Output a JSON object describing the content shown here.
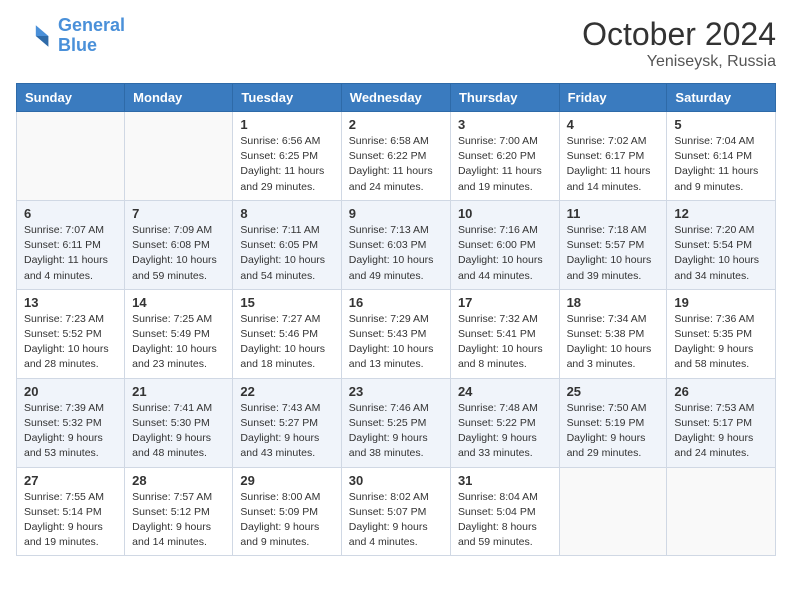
{
  "header": {
    "logo_line1": "General",
    "logo_line2": "Blue",
    "month": "October 2024",
    "location": "Yeniseysk, Russia"
  },
  "weekdays": [
    "Sunday",
    "Monday",
    "Tuesday",
    "Wednesday",
    "Thursday",
    "Friday",
    "Saturday"
  ],
  "weeks": [
    [
      {
        "day": "",
        "info": ""
      },
      {
        "day": "",
        "info": ""
      },
      {
        "day": "1",
        "info": "Sunrise: 6:56 AM\nSunset: 6:25 PM\nDaylight: 11 hours\nand 29 minutes."
      },
      {
        "day": "2",
        "info": "Sunrise: 6:58 AM\nSunset: 6:22 PM\nDaylight: 11 hours\nand 24 minutes."
      },
      {
        "day": "3",
        "info": "Sunrise: 7:00 AM\nSunset: 6:20 PM\nDaylight: 11 hours\nand 19 minutes."
      },
      {
        "day": "4",
        "info": "Sunrise: 7:02 AM\nSunset: 6:17 PM\nDaylight: 11 hours\nand 14 minutes."
      },
      {
        "day": "5",
        "info": "Sunrise: 7:04 AM\nSunset: 6:14 PM\nDaylight: 11 hours\nand 9 minutes."
      }
    ],
    [
      {
        "day": "6",
        "info": "Sunrise: 7:07 AM\nSunset: 6:11 PM\nDaylight: 11 hours\nand 4 minutes."
      },
      {
        "day": "7",
        "info": "Sunrise: 7:09 AM\nSunset: 6:08 PM\nDaylight: 10 hours\nand 59 minutes."
      },
      {
        "day": "8",
        "info": "Sunrise: 7:11 AM\nSunset: 6:05 PM\nDaylight: 10 hours\nand 54 minutes."
      },
      {
        "day": "9",
        "info": "Sunrise: 7:13 AM\nSunset: 6:03 PM\nDaylight: 10 hours\nand 49 minutes."
      },
      {
        "day": "10",
        "info": "Sunrise: 7:16 AM\nSunset: 6:00 PM\nDaylight: 10 hours\nand 44 minutes."
      },
      {
        "day": "11",
        "info": "Sunrise: 7:18 AM\nSunset: 5:57 PM\nDaylight: 10 hours\nand 39 minutes."
      },
      {
        "day": "12",
        "info": "Sunrise: 7:20 AM\nSunset: 5:54 PM\nDaylight: 10 hours\nand 34 minutes."
      }
    ],
    [
      {
        "day": "13",
        "info": "Sunrise: 7:23 AM\nSunset: 5:52 PM\nDaylight: 10 hours\nand 28 minutes."
      },
      {
        "day": "14",
        "info": "Sunrise: 7:25 AM\nSunset: 5:49 PM\nDaylight: 10 hours\nand 23 minutes."
      },
      {
        "day": "15",
        "info": "Sunrise: 7:27 AM\nSunset: 5:46 PM\nDaylight: 10 hours\nand 18 minutes."
      },
      {
        "day": "16",
        "info": "Sunrise: 7:29 AM\nSunset: 5:43 PM\nDaylight: 10 hours\nand 13 minutes."
      },
      {
        "day": "17",
        "info": "Sunrise: 7:32 AM\nSunset: 5:41 PM\nDaylight: 10 hours\nand 8 minutes."
      },
      {
        "day": "18",
        "info": "Sunrise: 7:34 AM\nSunset: 5:38 PM\nDaylight: 10 hours\nand 3 minutes."
      },
      {
        "day": "19",
        "info": "Sunrise: 7:36 AM\nSunset: 5:35 PM\nDaylight: 9 hours\nand 58 minutes."
      }
    ],
    [
      {
        "day": "20",
        "info": "Sunrise: 7:39 AM\nSunset: 5:32 PM\nDaylight: 9 hours\nand 53 minutes."
      },
      {
        "day": "21",
        "info": "Sunrise: 7:41 AM\nSunset: 5:30 PM\nDaylight: 9 hours\nand 48 minutes."
      },
      {
        "day": "22",
        "info": "Sunrise: 7:43 AM\nSunset: 5:27 PM\nDaylight: 9 hours\nand 43 minutes."
      },
      {
        "day": "23",
        "info": "Sunrise: 7:46 AM\nSunset: 5:25 PM\nDaylight: 9 hours\nand 38 minutes."
      },
      {
        "day": "24",
        "info": "Sunrise: 7:48 AM\nSunset: 5:22 PM\nDaylight: 9 hours\nand 33 minutes."
      },
      {
        "day": "25",
        "info": "Sunrise: 7:50 AM\nSunset: 5:19 PM\nDaylight: 9 hours\nand 29 minutes."
      },
      {
        "day": "26",
        "info": "Sunrise: 7:53 AM\nSunset: 5:17 PM\nDaylight: 9 hours\nand 24 minutes."
      }
    ],
    [
      {
        "day": "27",
        "info": "Sunrise: 7:55 AM\nSunset: 5:14 PM\nDaylight: 9 hours\nand 19 minutes."
      },
      {
        "day": "28",
        "info": "Sunrise: 7:57 AM\nSunset: 5:12 PM\nDaylight: 9 hours\nand 14 minutes."
      },
      {
        "day": "29",
        "info": "Sunrise: 8:00 AM\nSunset: 5:09 PM\nDaylight: 9 hours\nand 9 minutes."
      },
      {
        "day": "30",
        "info": "Sunrise: 8:02 AM\nSunset: 5:07 PM\nDaylight: 9 hours\nand 4 minutes."
      },
      {
        "day": "31",
        "info": "Sunrise: 8:04 AM\nSunset: 5:04 PM\nDaylight: 8 hours\nand 59 minutes."
      },
      {
        "day": "",
        "info": ""
      },
      {
        "day": "",
        "info": ""
      }
    ]
  ]
}
